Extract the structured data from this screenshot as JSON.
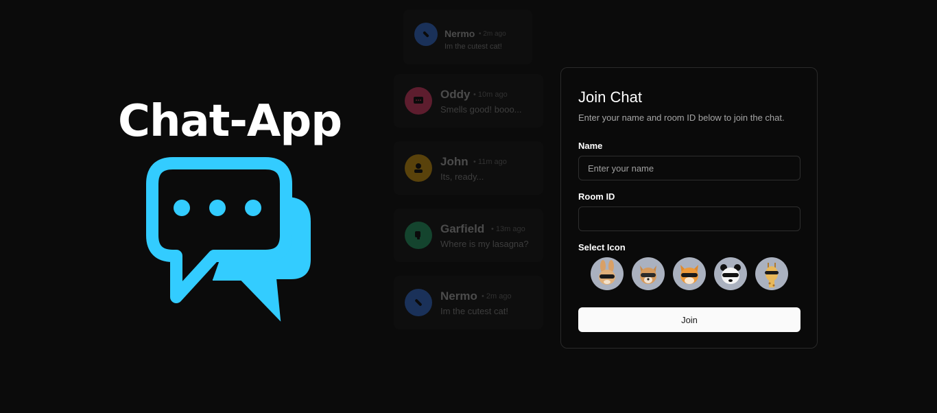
{
  "brand": {
    "title": "Chat-App",
    "logo_icon": "chat-bubbles-icon",
    "logo_color": "#33ccff"
  },
  "background_messages": [
    {
      "name": "Nermo",
      "time": "• 2m ago",
      "text": "Im the cutest cat!",
      "avatar_color": "#2d5fb8",
      "icon": "skateboard-icon"
    },
    {
      "name": "Oddy",
      "time": "• 10m ago",
      "text": "Smells good! booo...",
      "avatar_color": "#c2335a",
      "icon": "message-icon"
    },
    {
      "name": "John",
      "time": "• 11m ago",
      "text": "Its, ready...",
      "avatar_color": "#b8860b",
      "icon": "user-icon"
    },
    {
      "name": "Garfield",
      "time": "• 13m ago",
      "text": "Where is my lasagna?",
      "avatar_color": "#1f8a5a",
      "icon": "thumbs-down-icon"
    },
    {
      "name": "Nermo",
      "time": "• 2m ago",
      "text": "Im the cutest cat!",
      "avatar_color": "#2d5fb8",
      "icon": "skateboard-icon"
    }
  ],
  "join": {
    "title": "Join Chat",
    "subtitle": "Enter your name and room ID below to join the chat.",
    "name_label": "Name",
    "name_placeholder": "Enter your name",
    "name_value": "",
    "room_label": "Room ID",
    "room_placeholder": "",
    "room_value": "",
    "icon_label": "Select Icon",
    "icons": [
      "rabbit-icon",
      "dog-icon",
      "fox-icon",
      "panda-icon",
      "giraffe-icon"
    ],
    "button_label": "Join"
  }
}
